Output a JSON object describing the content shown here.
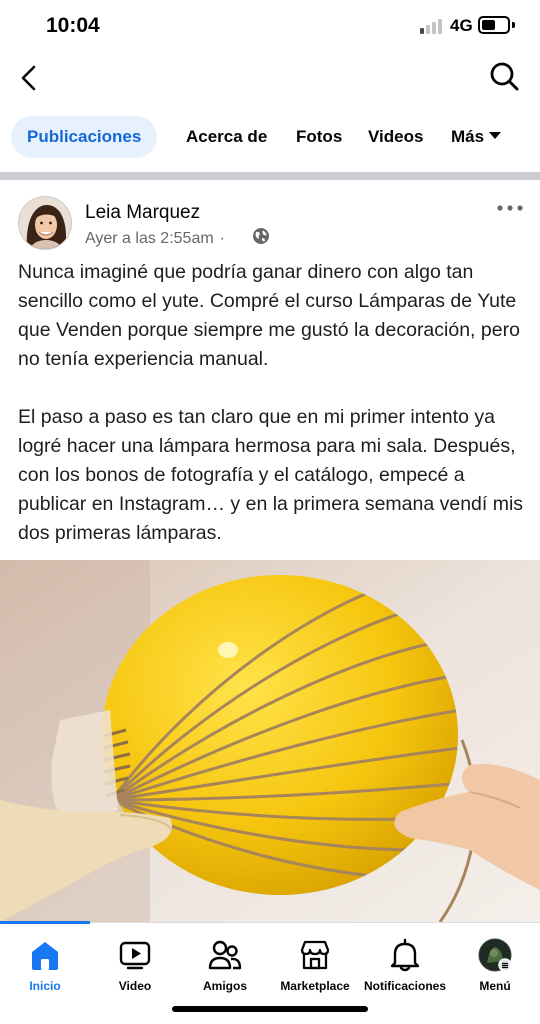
{
  "status_bar": {
    "time": "10:04",
    "network": "4G"
  },
  "header": {
    "back_icon": "back-chevron-icon",
    "search_icon": "search-icon"
  },
  "tabs": [
    {
      "label": "Publicaciones",
      "active": true
    },
    {
      "label": "Acerca de"
    },
    {
      "label": "Fotos"
    },
    {
      "label": "Videos"
    },
    {
      "label": "Más"
    }
  ],
  "post": {
    "author": "Leia Marquez",
    "timestamp": "Ayer a las 2:55am",
    "separator": "·",
    "privacy_icon": "globe-icon",
    "more_icon": "more-dots-icon",
    "paragraphs": [
      "Nunca imaginé que podría ganar dinero con algo tan sencillo como el yute. Compré el curso Lámparas de Yute que Venden porque siempre me gustó la decoración, pero no tenía experiencia manual.",
      "El paso a paso es tan claro que en mi primer intento ya logré hacer una lámpara hermosa para mi sala. Después, con los bonos de fotografía y el catálogo, empecé a publicar en Instagram… y en la primera semana vendí mis dos primeras lámparas."
    ]
  },
  "bottom_nav": [
    {
      "label": "Inicio",
      "icon": "home-icon",
      "active": true
    },
    {
      "label": "Video",
      "icon": "video-icon"
    },
    {
      "label": "Amigos",
      "icon": "friends-icon"
    },
    {
      "label": "Marketplace",
      "icon": "marketplace-icon"
    },
    {
      "label": "Notificaciones",
      "icon": "bell-icon"
    },
    {
      "label": "Menú",
      "icon": "profile-avatar-icon"
    }
  ],
  "colors": {
    "accent": "#1877f2",
    "tab_active_bg": "#e7f0fd",
    "balloon": "#f5c518",
    "twine": "#a8845a"
  }
}
